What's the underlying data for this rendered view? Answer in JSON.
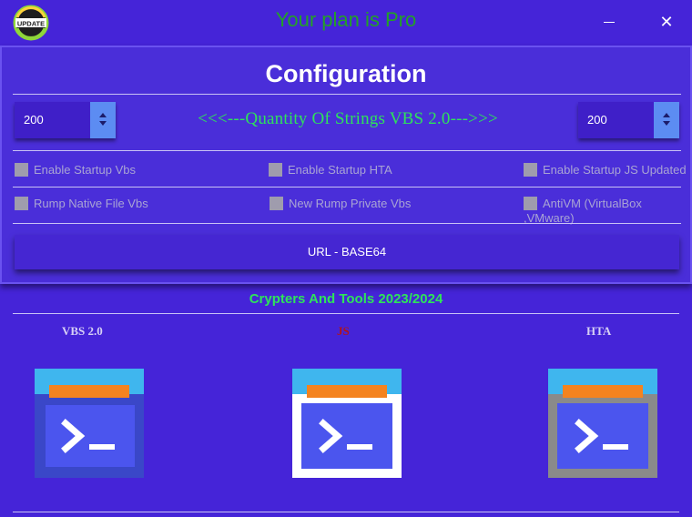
{
  "titlebar": {
    "logo_text": "UPDATE",
    "plan_title": "Your plan is Pro",
    "minimize_icon": "minimize-icon",
    "close_icon": "close-icon",
    "close_glyph": "✕"
  },
  "config": {
    "title": "Configuration",
    "left_quantity": "200",
    "right_quantity": "200",
    "quantity_label": "<<<---Quantity Of Strings VBS 2.0--->>>",
    "checkboxes": [
      {
        "label": "Enable Startup Vbs",
        "checked": false
      },
      {
        "label": "Enable Startup HTA",
        "checked": false
      },
      {
        "label": "Enable Startup JS Updated",
        "checked": false
      },
      {
        "label": "Rump Native File Vbs",
        "checked": false
      },
      {
        "label": "New Rump Private Vbs",
        "checked": false
      },
      {
        "label": "AntiVM  (VirtualBox ,VMware)",
        "checked": false
      }
    ],
    "url_button": "URL - BASE64"
  },
  "tools": {
    "title": "Crypters And Tools 2023/2024",
    "items": [
      {
        "label": "VBS 2.0",
        "color": "#d6d0f5",
        "icon": "terminal-icon"
      },
      {
        "label": "JS",
        "color": "#b0141c",
        "icon": "terminal-icon"
      },
      {
        "label": "HTA",
        "color": "#d6d0f5",
        "icon": "terminal-icon"
      }
    ]
  },
  "colors": {
    "background": "#4524d8",
    "accent_green": "#2ee35a",
    "title_green": "#23a127",
    "spinner_arrows": "#5c8cf2"
  }
}
